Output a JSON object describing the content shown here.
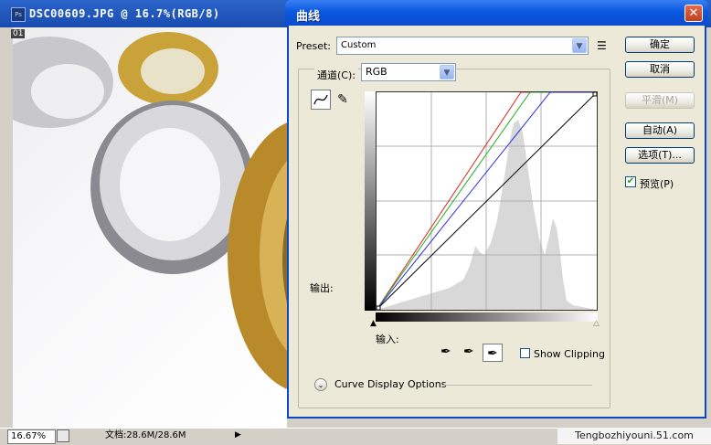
{
  "document": {
    "title": "DSC00609.JPG @ 16.7%(RGB/8)",
    "zoom": "16.67%",
    "doc_size": "文档:28.6M/28.6M",
    "label_01": "01"
  },
  "watermark": "Tengbozhiyouni.51.com",
  "dialog": {
    "title": "曲线",
    "close_glyph": "✕",
    "preset_label": "Preset:",
    "preset_value": "Custom",
    "channel_label": "通道(C):",
    "channel_value": "RGB",
    "output_label": "输出:",
    "input_label": "输入:",
    "show_clipping": "Show Clipping",
    "curve_display_options": "Curve Display Options",
    "buttons": {
      "ok": "确定",
      "cancel": "取消",
      "smooth": "平滑(M)",
      "auto": "自动(A)",
      "options": "选项(T)..."
    },
    "preview_label": "预览(P)",
    "preview_checked": true,
    "show_clipping_checked": false
  },
  "colors": {
    "curve_red": "#e02020",
    "curve_green": "#20b020",
    "curve_blue": "#2828e0",
    "curve_rgb": "#000000",
    "histogram": "#d8d8d8"
  }
}
